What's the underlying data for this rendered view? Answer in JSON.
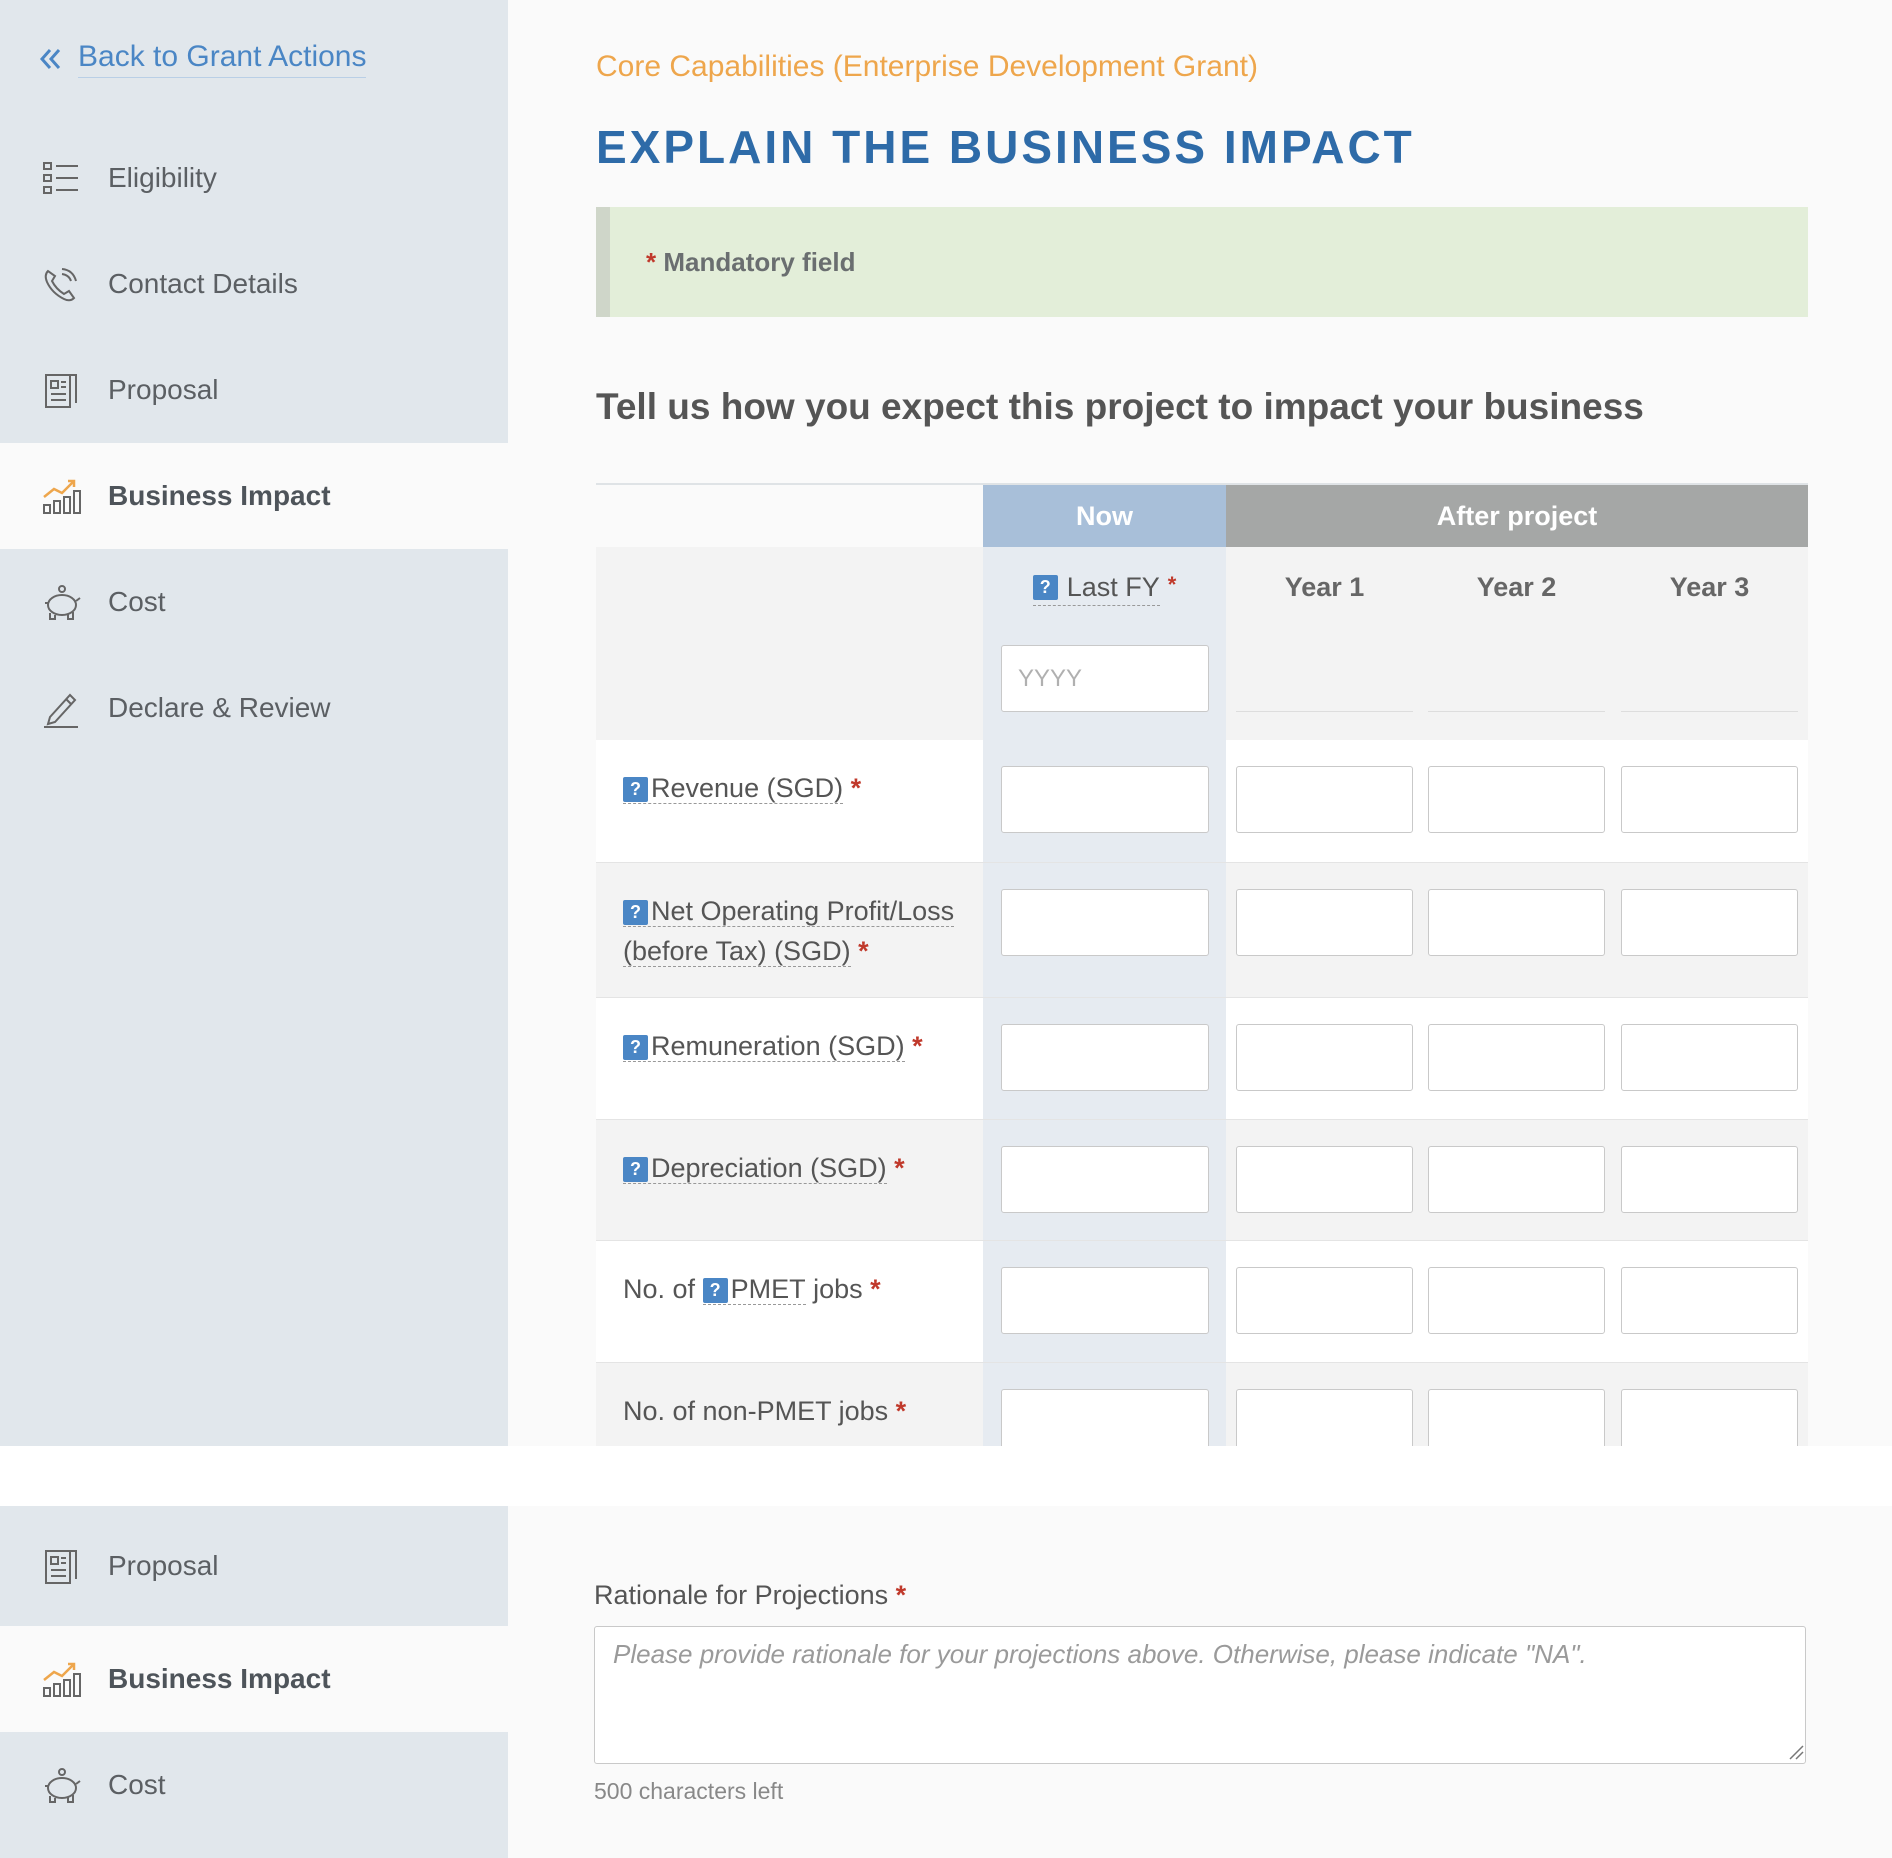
{
  "sidebar_top": {
    "back_link": "Back to Grant Actions",
    "items": [
      {
        "label": "Eligibility"
      },
      {
        "label": "Contact Details"
      },
      {
        "label": "Proposal"
      },
      {
        "label": "Business Impact"
      },
      {
        "label": "Cost"
      },
      {
        "label": "Declare & Review"
      }
    ]
  },
  "sidebar_bottom": {
    "items": [
      {
        "label": "Proposal"
      },
      {
        "label": "Business Impact"
      },
      {
        "label": "Cost"
      }
    ]
  },
  "header": {
    "breadcrumb": "Core Capabilities (Enterprise Development Grant)",
    "title": "EXPLAIN THE BUSINESS IMPACT"
  },
  "notice": {
    "asterisk": "*",
    "text": "Mandatory field"
  },
  "section_title": "Tell us how you expect this project to impact your business",
  "table": {
    "now_header": "Now",
    "after_header": "After project",
    "last_fy_label": "Last FY",
    "year_placeholder": "YYYY",
    "years": [
      "Year 1",
      "Year 2",
      "Year 3"
    ],
    "question_mark": "?",
    "asterisk": "*",
    "rows": [
      {
        "label": "Revenue (SGD)"
      },
      {
        "label": "Net Operating Profit/Loss (before Tax) (SGD)"
      },
      {
        "label": "Remuneration (SGD)"
      },
      {
        "label": "Depreciation (SGD)"
      },
      {
        "prefix": "No. of",
        "label": "PMET",
        "suffix": "jobs"
      },
      {
        "label": "No. of non-PMET jobs"
      }
    ]
  },
  "rationale": {
    "label": "Rationale for Projections",
    "asterisk": "*",
    "placeholder": "Please provide rationale for your projections above. Otherwise, please indicate \"NA\".",
    "chars_left": "500 characters left"
  },
  "colors": {
    "accent_blue": "#2e6ba8",
    "link_blue": "#4a86c5",
    "breadcrumb_orange": "#eea64c",
    "notice_green": "#e3eed9",
    "now_header": "#a8bfd9",
    "after_header": "#a5a7a6",
    "required_red": "#c0392b"
  }
}
